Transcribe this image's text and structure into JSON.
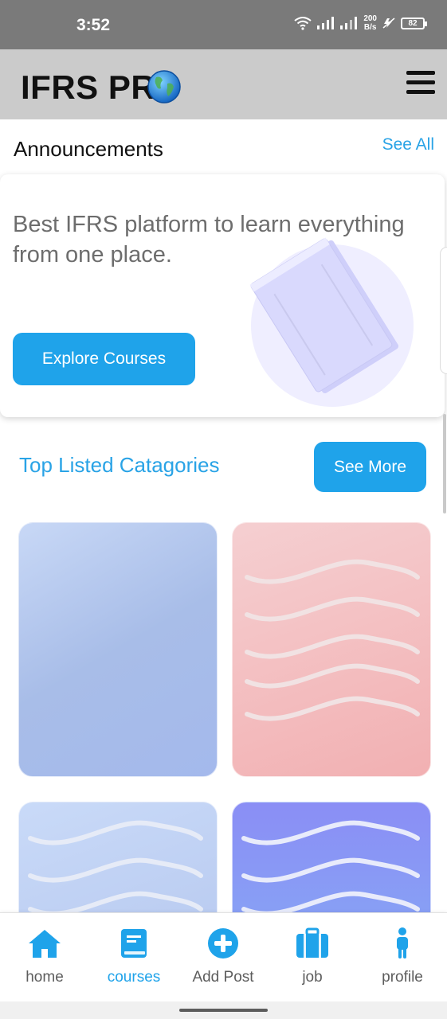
{
  "status_bar": {
    "time": "3:52",
    "net_speed_value": "200",
    "net_speed_unit": "B/s",
    "battery": "82"
  },
  "header": {
    "title": "IFRS PR",
    "logo_icon": "globe-icon",
    "menu_icon": "hamburger-menu-icon"
  },
  "announcements": {
    "title": "Announcements",
    "see_all": "See All"
  },
  "banner": {
    "text": "Best IFRS platform to learn everything from one place.",
    "button": "Explore Courses",
    "illustration_icon": "book-illustration"
  },
  "categories": {
    "title": "Top Listed Catagories",
    "see_more": "See More",
    "cards": [
      {
        "pattern": "plain"
      },
      {
        "pattern": "waves"
      },
      {
        "pattern": "waves"
      },
      {
        "pattern": "waves"
      }
    ]
  },
  "nav": {
    "items": [
      {
        "label": "home",
        "icon": "home-icon"
      },
      {
        "label": "courses",
        "icon": "book-icon",
        "active": true
      },
      {
        "label": "Add Post",
        "icon": "plus-circle-icon"
      },
      {
        "label": "job",
        "icon": "briefcase-icon"
      },
      {
        "label": "profile",
        "icon": "person-icon"
      }
    ]
  },
  "colors": {
    "accent": "#1fa3ea",
    "header_bg": "#cbcbcb",
    "status_bg": "#7a7a7a"
  }
}
